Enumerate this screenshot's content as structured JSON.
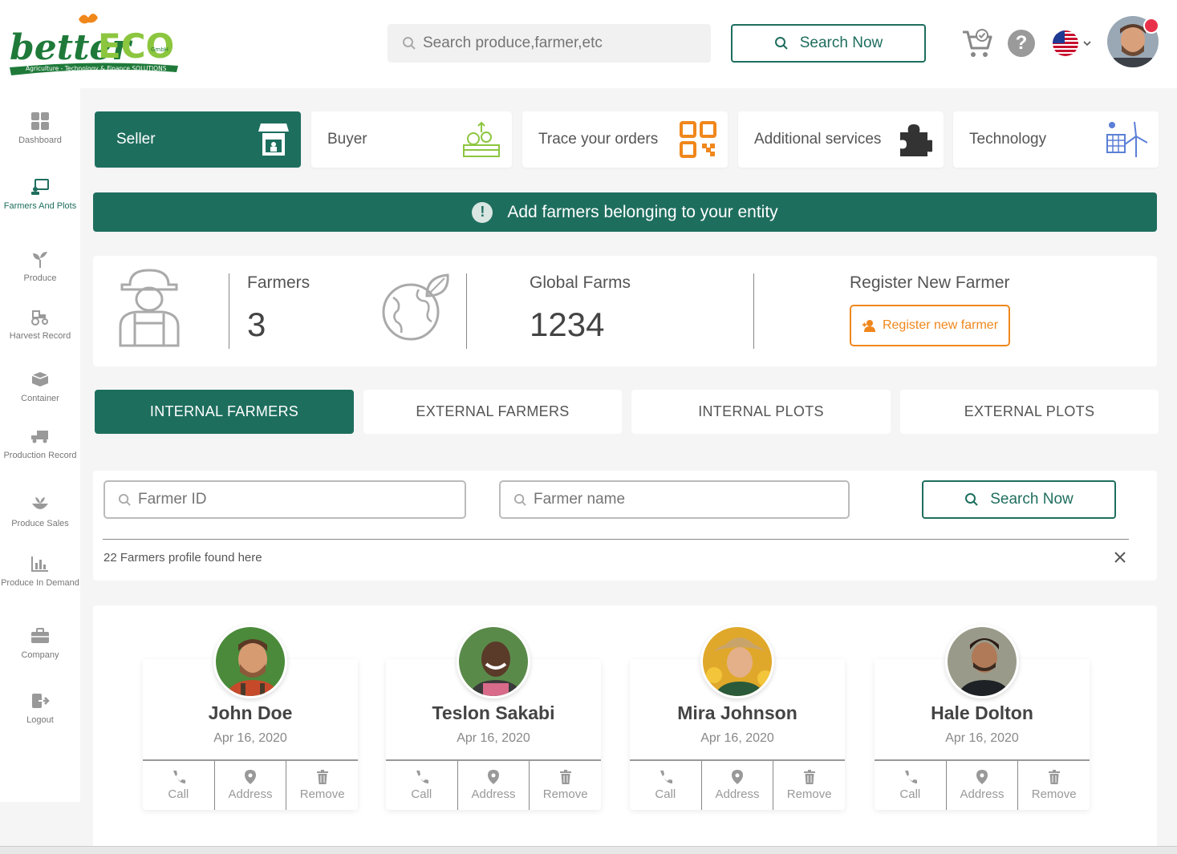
{
  "header": {
    "logo_text": "betterECO",
    "logo_sub": "GmbH",
    "logo_tagline": "Agriculture - Technology & Finance SOLUTIONS",
    "search_placeholder": "Search produce,farmer,etc",
    "search_button": "Search Now",
    "help_label": "?"
  },
  "sidebar": {
    "items": [
      {
        "label": "Dashboard",
        "icon": "dashboard-icon"
      },
      {
        "label": "Farmers And Plots",
        "icon": "farmers-icon"
      },
      {
        "label": "Produce",
        "icon": "sprout-icon"
      },
      {
        "label": "Harvest Record",
        "icon": "tractor-icon"
      },
      {
        "label": "Container",
        "icon": "container-icon"
      },
      {
        "label": "Production Record",
        "icon": "truck-icon"
      },
      {
        "label": "Produce Sales",
        "icon": "sales-icon"
      },
      {
        "label": "Produce In Demand",
        "icon": "chart-icon"
      },
      {
        "label": "Company",
        "icon": "briefcase-icon"
      },
      {
        "label": "Logout",
        "icon": "logout-icon"
      }
    ]
  },
  "categories": [
    {
      "label": "Seller",
      "icon": "store-icon"
    },
    {
      "label": "Buyer",
      "icon": "basket-icon"
    },
    {
      "label": "Trace your orders",
      "icon": "qr-icon"
    },
    {
      "label": "Additional services",
      "icon": "puzzle-icon"
    },
    {
      "label": "Technology",
      "icon": "energy-icon"
    }
  ],
  "banner": {
    "text": "Add farmers belonging to your entity",
    "icon": "!"
  },
  "stats": {
    "farmers_label": "Farmers",
    "farmers_value": "3",
    "global_label": "Global Farms",
    "global_value": "1234",
    "register_label": "Register New Farmer",
    "register_button": "Register new farmer"
  },
  "farmer_tabs": [
    "INTERNAL FARMERS",
    "EXTERNAL FARMERS",
    "INTERNAL PLOTS",
    "EXTERNAL PLOTS"
  ],
  "filter": {
    "farmer_id_placeholder": "Farmer ID",
    "farmer_name_placeholder": "Farmer name",
    "search_button": "Search Now",
    "found_text": "22 Farmers profile found here",
    "close": "×"
  },
  "farmers": [
    {
      "name": "John Doe",
      "date": "Apr 16, 2020"
    },
    {
      "name": "Teslon Sakabi",
      "date": "Apr 16, 2020"
    },
    {
      "name": "Mira Johnson",
      "date": "Apr 16, 2020"
    },
    {
      "name": "Hale Dolton",
      "date": "Apr 16, 2020"
    }
  ],
  "card_actions": {
    "call": "Call",
    "address": "Address",
    "remove": "Remove"
  },
  "colors": {
    "primary": "#1e6e5e",
    "accent": "#f0871c",
    "logo_green": "#1f7a3a",
    "logo_lime": "#8cc63f"
  }
}
